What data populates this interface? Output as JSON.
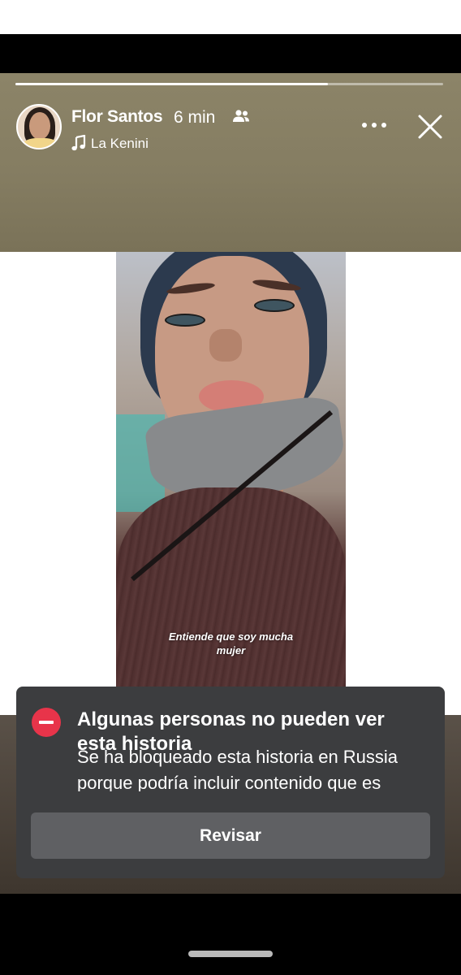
{
  "story": {
    "progress_fraction": 0.73,
    "user_name": "Flor Santos",
    "time": "6 min",
    "audience_icon": "friends-icon",
    "song_icon": "music-note-icon",
    "song": "La Kenini",
    "more_icon": "more-horizontal-icon",
    "close_icon": "close-icon",
    "photo_caption_line1": "Entiende que soy mucha",
    "photo_caption_line2": "mujer",
    "top_color": "#857d62",
    "bottom_color": "#4a4038"
  },
  "notice": {
    "icon": "blocked-icon",
    "title": "Algunas personas no pueden ver esta historia",
    "body": "Se ha bloqueado esta historia en Russia porque podría incluir contenido que es propiedad de otra persona.",
    "button_label": "Revisar",
    "background": "#3c3d3f",
    "accent": "#e8344a"
  }
}
